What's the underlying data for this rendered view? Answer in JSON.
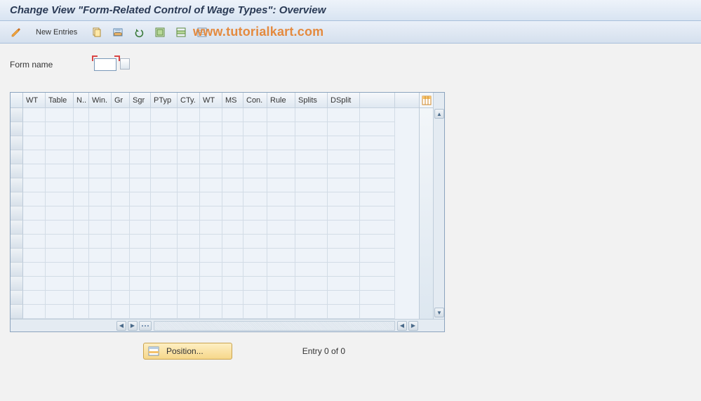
{
  "title": "Change View \"Form-Related Control of Wage Types\": Overview",
  "toolbar": {
    "new_entries": "New Entries"
  },
  "watermark": "www.tutorialkart.com",
  "form": {
    "name_label": "Form name",
    "name_value": ""
  },
  "table": {
    "columns": [
      "WT",
      "Table",
      "N..",
      "Win.",
      "Gr",
      "Sgr",
      "PTyp",
      "CTy.",
      "WT",
      "MS",
      "Con.",
      "Rule",
      "Splits",
      "DSplit"
    ],
    "rows": [
      [
        "",
        "",
        "",
        "",
        "",
        "",
        "",
        "",
        "",
        "",
        "",
        "",
        "",
        ""
      ],
      [
        "",
        "",
        "",
        "",
        "",
        "",
        "",
        "",
        "",
        "",
        "",
        "",
        "",
        ""
      ],
      [
        "",
        "",
        "",
        "",
        "",
        "",
        "",
        "",
        "",
        "",
        "",
        "",
        "",
        ""
      ],
      [
        "",
        "",
        "",
        "",
        "",
        "",
        "",
        "",
        "",
        "",
        "",
        "",
        "",
        ""
      ],
      [
        "",
        "",
        "",
        "",
        "",
        "",
        "",
        "",
        "",
        "",
        "",
        "",
        "",
        ""
      ],
      [
        "",
        "",
        "",
        "",
        "",
        "",
        "",
        "",
        "",
        "",
        "",
        "",
        "",
        ""
      ],
      [
        "",
        "",
        "",
        "",
        "",
        "",
        "",
        "",
        "",
        "",
        "",
        "",
        "",
        ""
      ],
      [
        "",
        "",
        "",
        "",
        "",
        "",
        "",
        "",
        "",
        "",
        "",
        "",
        "",
        ""
      ],
      [
        "",
        "",
        "",
        "",
        "",
        "",
        "",
        "",
        "",
        "",
        "",
        "",
        "",
        ""
      ],
      [
        "",
        "",
        "",
        "",
        "",
        "",
        "",
        "",
        "",
        "",
        "",
        "",
        "",
        ""
      ],
      [
        "",
        "",
        "",
        "",
        "",
        "",
        "",
        "",
        "",
        "",
        "",
        "",
        "",
        ""
      ],
      [
        "",
        "",
        "",
        "",
        "",
        "",
        "",
        "",
        "",
        "",
        "",
        "",
        "",
        ""
      ],
      [
        "",
        "",
        "",
        "",
        "",
        "",
        "",
        "",
        "",
        "",
        "",
        "",
        "",
        ""
      ],
      [
        "",
        "",
        "",
        "",
        "",
        "",
        "",
        "",
        "",
        "",
        "",
        "",
        "",
        ""
      ],
      [
        "",
        "",
        "",
        "",
        "",
        "",
        "",
        "",
        "",
        "",
        "",
        "",
        "",
        ""
      ]
    ]
  },
  "footer": {
    "position_label": "Position...",
    "entry_label": "Entry 0 of 0"
  }
}
